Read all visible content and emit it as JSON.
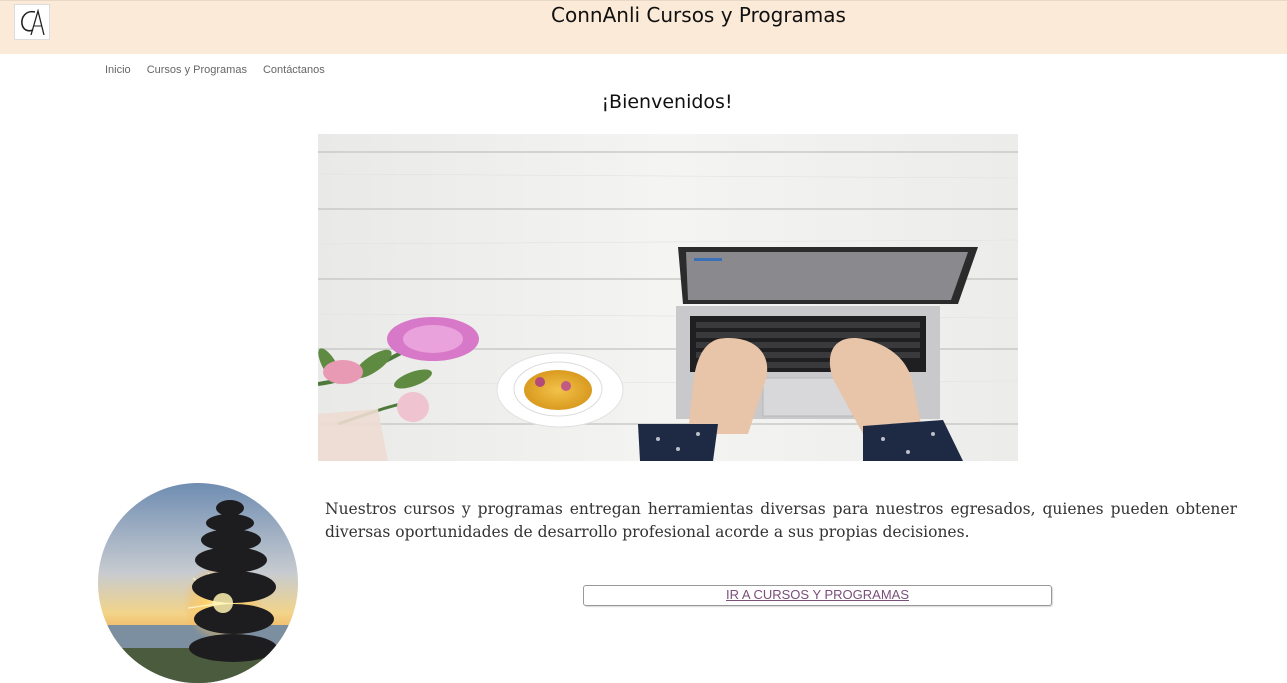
{
  "header": {
    "title": "ConnAnli Cursos y Programas",
    "logo_icon": "ca-monogram-logo-icon",
    "background": "#fbead7"
  },
  "nav": {
    "items": [
      "Inicio",
      "Cursos y Programas",
      "Contáctanos"
    ]
  },
  "main": {
    "heading": "¡Bienvenidos!",
    "hero_image": "laptop-flowers-tea-photo",
    "side_image": "stacked-stones-sunset-photo",
    "description": "Nuestros cursos y programas entregan herramientas diversas para nuestros egresados, quienes pueden obtener diversas oportunidades de desarrollo profesional acorde a sus propias decisiones.",
    "cta_label": "IR A CURSOS Y PROGRAMAS",
    "cta_color": "#7a4f7a"
  }
}
